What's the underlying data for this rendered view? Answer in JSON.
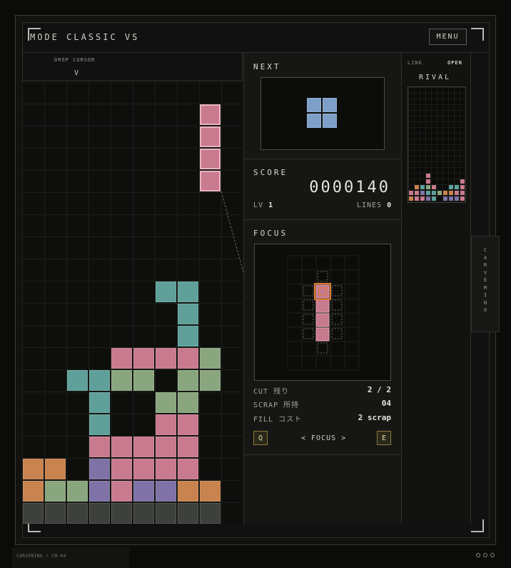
{
  "header": {
    "mode_label": "MODE CLASSIC VS",
    "menu_label": "MENU"
  },
  "cursor": {
    "label": "DROP CURSOR",
    "marker": "V"
  },
  "next": {
    "title": "NEXT",
    "piece": "O",
    "color": "#7ea0c8"
  },
  "score": {
    "title": "SCORE",
    "value": "0000140",
    "level_label": "LV",
    "level": "1",
    "lines_label": "LINES",
    "lines": "0"
  },
  "focus": {
    "title": "FOCUS",
    "rows": [
      {
        "label": "CUT 残り",
        "value": "2 / 2"
      },
      {
        "label": "SCRAP 所持",
        "value": "04"
      },
      {
        "label": "FILL コスト",
        "value": "2 scrap"
      }
    ],
    "prev_key": "Q",
    "next_key": "E",
    "nav_label": "< FOCUS >"
  },
  "rival": {
    "link_label": "LINK",
    "link_status": "OPEN",
    "title": "RIVAL"
  },
  "side_tab": "CARVEMINO",
  "footer": {
    "text": "CARVEMINO / CM-04"
  },
  "colors": {
    "pink": "#c87a8e",
    "teal": "#5fa09a",
    "sage": "#8aa67e",
    "purple": "#7e72a6",
    "orange": "#c9834f",
    "gray": "#3e403c",
    "blue": "#7ea0c8",
    "focus_accent": "#e07a2a"
  },
  "board": {
    "cols": 10,
    "rows": 20,
    "active_piece": {
      "type": "I",
      "color": "pink",
      "cells": [
        [
          8,
          1
        ],
        [
          8,
          2
        ],
        [
          8,
          3
        ],
        [
          8,
          4
        ]
      ]
    },
    "cells": [
      [
        6,
        9,
        "teal"
      ],
      [
        7,
        9,
        "teal"
      ],
      [
        7,
        10,
        "teal"
      ],
      [
        7,
        11,
        "teal"
      ],
      [
        4,
        12,
        "pink"
      ],
      [
        5,
        12,
        "pink"
      ],
      [
        6,
        12,
        "pink"
      ],
      [
        7,
        12,
        "pink"
      ],
      [
        8,
        12,
        "sage"
      ],
      [
        2,
        13,
        "teal"
      ],
      [
        3,
        13,
        "teal"
      ],
      [
        4,
        13,
        "sage"
      ],
      [
        5,
        13,
        "sage"
      ],
      [
        7,
        13,
        "sage"
      ],
      [
        8,
        13,
        "sage"
      ],
      [
        3,
        14,
        "teal"
      ],
      [
        6,
        14,
        "sage"
      ],
      [
        7,
        14,
        "sage"
      ],
      [
        3,
        15,
        "teal"
      ],
      [
        6,
        15,
        "pink"
      ],
      [
        7,
        15,
        "pink"
      ],
      [
        3,
        16,
        "pink"
      ],
      [
        4,
        16,
        "pink"
      ],
      [
        5,
        16,
        "pink"
      ],
      [
        6,
        16,
        "pink"
      ],
      [
        7,
        16,
        "pink"
      ],
      [
        0,
        17,
        "orange"
      ],
      [
        1,
        17,
        "orange"
      ],
      [
        3,
        17,
        "purple"
      ],
      [
        4,
        17,
        "pink"
      ],
      [
        5,
        17,
        "pink"
      ],
      [
        6,
        17,
        "pink"
      ],
      [
        7,
        17,
        "pink"
      ],
      [
        0,
        18,
        "orange"
      ],
      [
        1,
        18,
        "sage"
      ],
      [
        2,
        18,
        "sage"
      ],
      [
        3,
        18,
        "purple"
      ],
      [
        4,
        18,
        "pink"
      ],
      [
        5,
        18,
        "purple"
      ],
      [
        6,
        18,
        "purple"
      ],
      [
        7,
        18,
        "orange"
      ],
      [
        8,
        18,
        "orange"
      ],
      [
        0,
        19,
        "gray"
      ],
      [
        1,
        19,
        "gray"
      ],
      [
        2,
        19,
        "gray"
      ],
      [
        3,
        19,
        "gray"
      ],
      [
        4,
        19,
        "gray"
      ],
      [
        5,
        19,
        "gray"
      ],
      [
        6,
        19,
        "gray"
      ],
      [
        7,
        19,
        "gray"
      ],
      [
        8,
        19,
        "gray"
      ]
    ]
  },
  "rival_board": {
    "cols": 10,
    "rows": 20,
    "cells": [
      [
        3,
        15,
        "pink"
      ],
      [
        3,
        16,
        "pink"
      ],
      [
        9,
        16,
        "pink"
      ],
      [
        1,
        17,
        "orange"
      ],
      [
        2,
        17,
        "teal"
      ],
      [
        3,
        17,
        "sage"
      ],
      [
        4,
        17,
        "pink"
      ],
      [
        7,
        17,
        "teal"
      ],
      [
        8,
        17,
        "teal"
      ],
      [
        9,
        17,
        "pink"
      ],
      [
        0,
        18,
        "pink"
      ],
      [
        1,
        18,
        "pink"
      ],
      [
        2,
        18,
        "purple"
      ],
      [
        3,
        18,
        "teal"
      ],
      [
        4,
        18,
        "teal"
      ],
      [
        5,
        18,
        "sage"
      ],
      [
        6,
        18,
        "orange"
      ],
      [
        7,
        18,
        "orange"
      ],
      [
        8,
        18,
        "pink"
      ],
      [
        9,
        18,
        "pink"
      ],
      [
        0,
        19,
        "orange"
      ],
      [
        1,
        19,
        "pink"
      ],
      [
        2,
        19,
        "pink"
      ],
      [
        3,
        19,
        "purple"
      ],
      [
        4,
        19,
        "teal"
      ],
      [
        6,
        19,
        "purple"
      ],
      [
        7,
        19,
        "purple"
      ],
      [
        8,
        19,
        "purple"
      ],
      [
        9,
        19,
        "pink"
      ]
    ]
  }
}
